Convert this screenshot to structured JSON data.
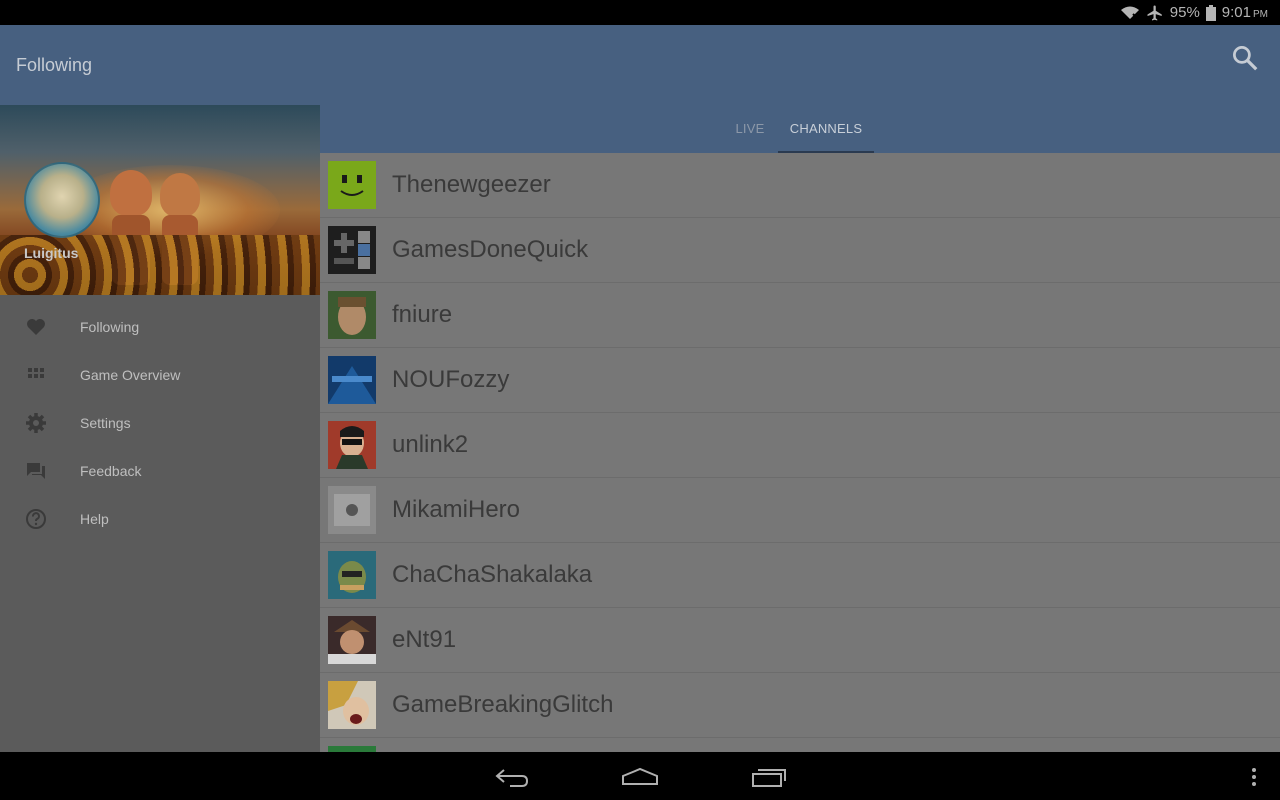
{
  "status_bar": {
    "battery": "95%",
    "time": "9:01",
    "ampm": "PM",
    "icons": [
      "wifi-icon",
      "airplane-icon",
      "battery-icon"
    ]
  },
  "action_bar": {
    "title": "Following",
    "search_icon": "search-icon"
  },
  "tabs": [
    {
      "label": "LIVE",
      "selected": false
    },
    {
      "label": "CHANNELS",
      "selected": true
    }
  ],
  "drawer": {
    "username": "Luigitus",
    "items": [
      {
        "label": "Following",
        "icon": "heart-icon"
      },
      {
        "label": "Game Overview",
        "icon": "grid-icon"
      },
      {
        "label": "Settings",
        "icon": "gear-icon"
      },
      {
        "label": "Feedback",
        "icon": "chat-icon"
      },
      {
        "label": "Help",
        "icon": "help-icon"
      }
    ]
  },
  "channels": [
    {
      "name": "Thenewgeezer"
    },
    {
      "name": "GamesDoneQuick"
    },
    {
      "name": "fniure"
    },
    {
      "name": "NOUFozzy"
    },
    {
      "name": "unlink2"
    },
    {
      "name": "MikamiHero"
    },
    {
      "name": "ChaChaShakalaka"
    },
    {
      "name": "eNt91"
    },
    {
      "name": "GameBreakingGlitch"
    }
  ],
  "nav_bar": {
    "icons": [
      "back-icon",
      "home-icon",
      "recent-apps-icon",
      "overflow-menu-icon"
    ]
  }
}
